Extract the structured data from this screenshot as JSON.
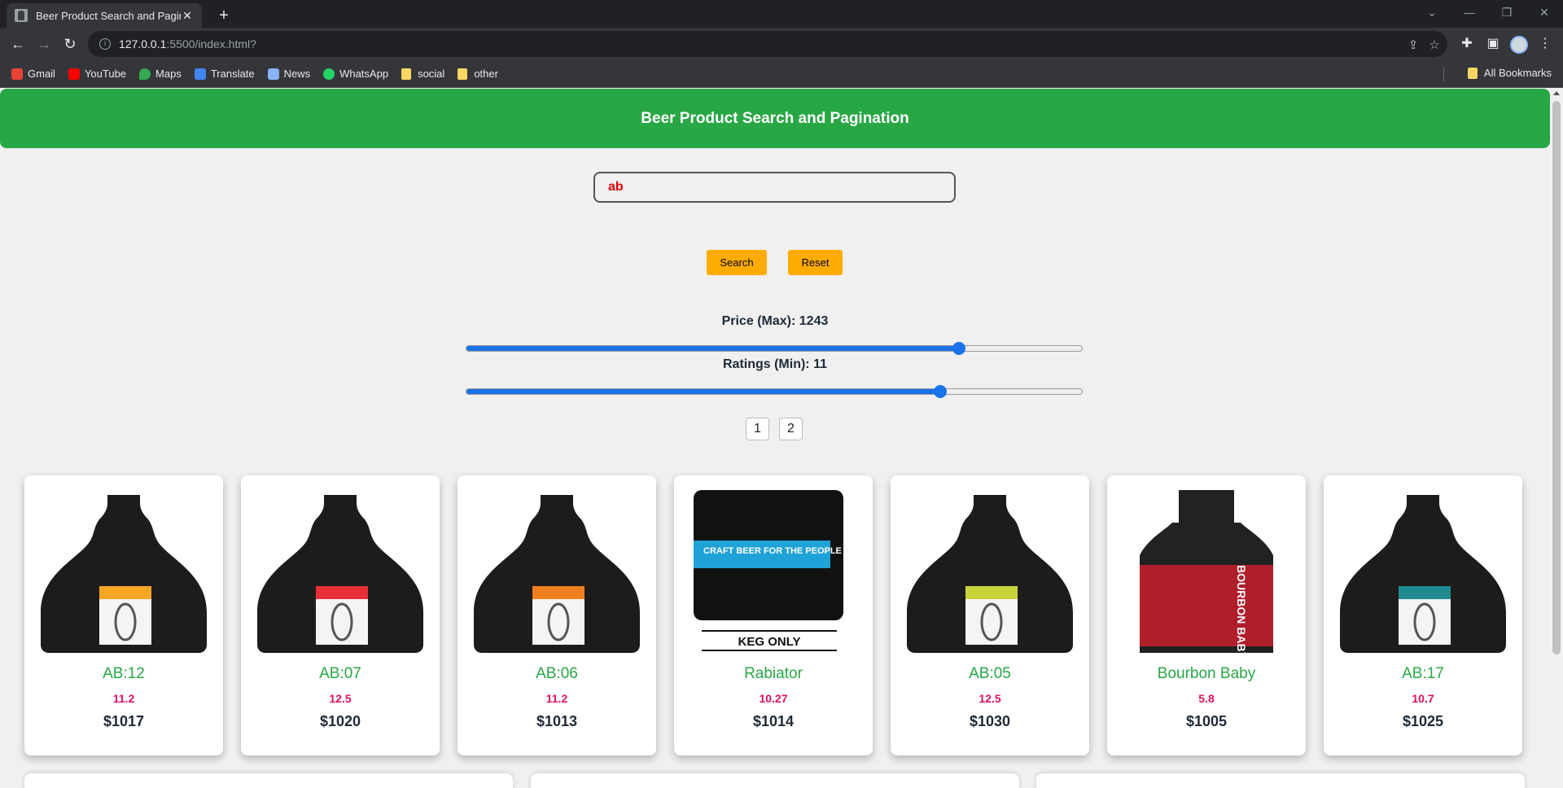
{
  "browser": {
    "tab_title": "Beer Product Search and Paginat",
    "tab_close": "✕",
    "new_tab": "+",
    "url_host": "127.0.0.1",
    "url_path": ":5500/index.html?",
    "bookmarks": [
      {
        "label": "Gmail",
        "color": "#ea4335"
      },
      {
        "label": "YouTube",
        "color": "#ff0000"
      },
      {
        "label": "Maps",
        "color": "#34a853"
      },
      {
        "label": "Translate",
        "color": "#4285f4"
      },
      {
        "label": "News",
        "color": "#8ab4f8"
      },
      {
        "label": "WhatsApp",
        "color": "#25d366"
      }
    ],
    "folders": [
      "social",
      "other"
    ],
    "all_bookmarks": "All Bookmarks"
  },
  "page": {
    "title": "Beer Product Search and Pagination",
    "search_value": "ab",
    "search_button": "Search",
    "reset_button": "Reset",
    "price_label": "Price (Max): 1243",
    "price_fraction": 0.8,
    "ratings_label": "Ratings (Min): 11",
    "ratings_fraction": 0.77,
    "pages": [
      "1",
      "2"
    ],
    "accent_green": "#28a745",
    "accent_orange": "#ffab00"
  },
  "products": [
    {
      "name": "AB:12",
      "rating": "11.2",
      "price": "$1017",
      "image": "bottle",
      "label_color": "#f5a623"
    },
    {
      "name": "AB:07",
      "rating": "12.5",
      "price": "$1020",
      "image": "bottle",
      "label_color": "#e8303a"
    },
    {
      "name": "AB:06",
      "rating": "11.2",
      "price": "$1013",
      "image": "bottle",
      "label_color": "#f07f20"
    },
    {
      "name": "Rabiator",
      "rating": "10.27",
      "price": "$1014",
      "image": "keg",
      "keg_text": "CRAFT BEER FOR THE PEOPLE",
      "keg_only": "KEG ONLY"
    },
    {
      "name": "AB:05",
      "rating": "12.5",
      "price": "$1030",
      "image": "bottle",
      "label_color": "#c8d43a"
    },
    {
      "name": "Bourbon Baby",
      "rating": "5.8",
      "price": "$1005",
      "image": "tall",
      "label_text": "BOURBON BABY"
    },
    {
      "name": "AB:17",
      "rating": "10.7",
      "price": "$1025",
      "image": "bottle",
      "label_color": "#1f8a8f"
    }
  ]
}
